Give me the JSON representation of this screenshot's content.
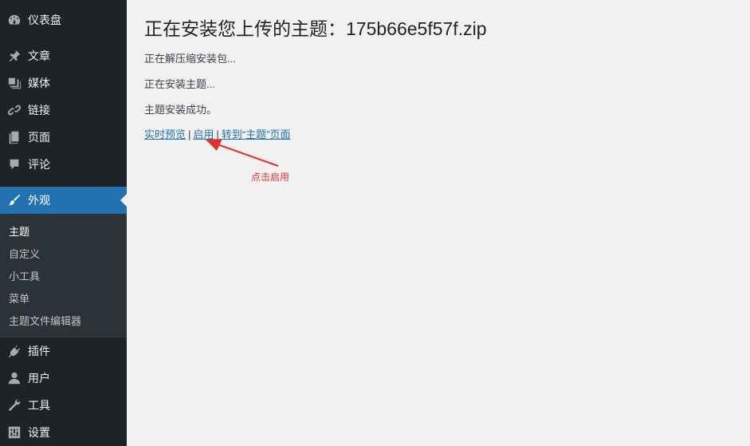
{
  "sidebar": {
    "items": [
      {
        "label": "仪表盘",
        "icon": "dashboard-icon"
      },
      {
        "label": "文章",
        "icon": "pin-icon"
      },
      {
        "label": "媒体",
        "icon": "media-icon"
      },
      {
        "label": "链接",
        "icon": "link-icon"
      },
      {
        "label": "页面",
        "icon": "page-icon"
      },
      {
        "label": "评论",
        "icon": "comment-icon"
      },
      {
        "label": "外观",
        "icon": "paintbrush-icon"
      },
      {
        "label": "插件",
        "icon": "plugin-icon"
      },
      {
        "label": "用户",
        "icon": "user-icon"
      },
      {
        "label": "工具",
        "icon": "wrench-icon"
      },
      {
        "label": "设置",
        "icon": "settings-icon"
      }
    ],
    "active_item": "外观",
    "submenu": [
      {
        "label": "主题"
      },
      {
        "label": "自定义"
      },
      {
        "label": "小工具"
      },
      {
        "label": "菜单"
      },
      {
        "label": "主题文件编辑器"
      }
    ]
  },
  "main": {
    "title": "正在安装您上传的主题：175b66e5f57f.zip",
    "messages": [
      "正在解压缩安装包...",
      "正在安装主题...",
      "主题安装成功。"
    ],
    "actions": {
      "live_preview": "实时预览",
      "activate": "启用",
      "goto_themes": "转到“主题”页面",
      "separator": "|"
    },
    "annotation": "点击启用"
  },
  "colors": {
    "sidebar_bg": "#1d2327",
    "active_bg": "#2271b1",
    "link": "#2271b1",
    "annotation": "#e03232"
  }
}
